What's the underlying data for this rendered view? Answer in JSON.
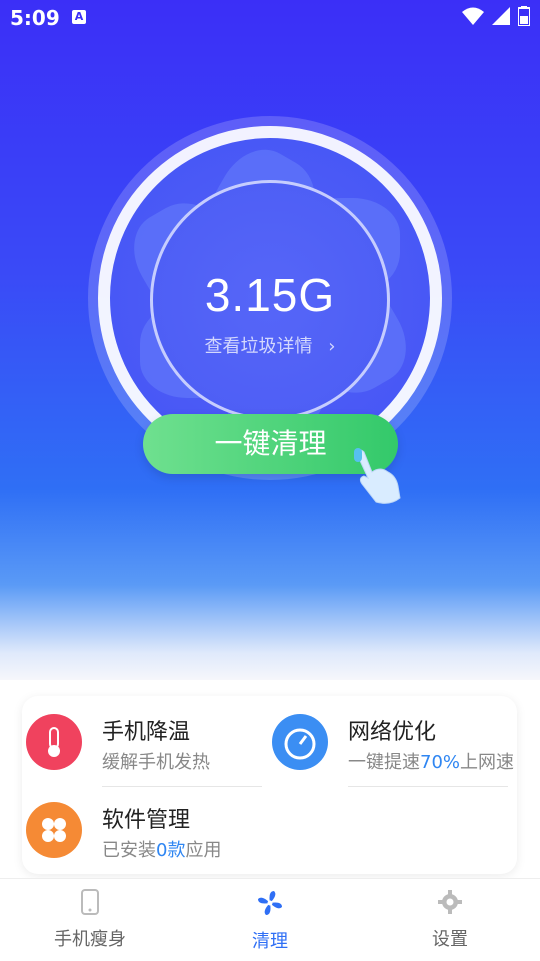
{
  "status_bar": {
    "time": "5:09",
    "notification_icon": "A"
  },
  "hero": {
    "junk_size": "3.15G",
    "view_details": "查看垃圾详情",
    "clean_button": "一键清理"
  },
  "tools": [
    {
      "icon": "thermometer-icon",
      "title": "手机降温",
      "subtitle": "缓解手机发热",
      "color": "#f0425e"
    },
    {
      "icon": "speedometer-icon",
      "title": "网络优化",
      "sub_prefix": "一键提速",
      "sub_highlight": "70%",
      "sub_suffix": "上网速",
      "color": "#3b8ef3"
    },
    {
      "icon": "apps-icon",
      "title": "软件管理",
      "sub_prefix": "已安装",
      "sub_highlight": "0款",
      "sub_suffix": "应用",
      "color": "#f58a35"
    }
  ],
  "nav": {
    "items": [
      {
        "label": "手机瘦身",
        "icon": "phone-icon"
      },
      {
        "label": "清理",
        "icon": "fan-icon",
        "active": true
      },
      {
        "label": "设置",
        "icon": "gear-icon"
      }
    ]
  },
  "colors": {
    "accent": "#2f6ff5",
    "clean_green": "#33c96a"
  }
}
